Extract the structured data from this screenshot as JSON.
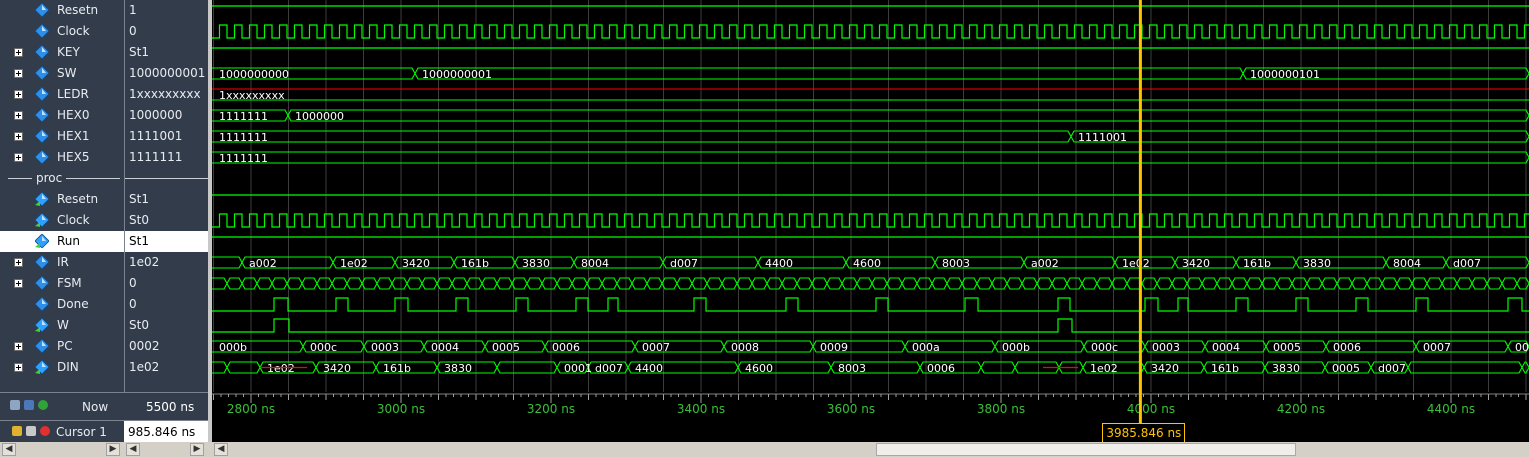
{
  "signals": [
    {
      "name": "Resetn",
      "value": "1",
      "expandable": false,
      "kind": "in"
    },
    {
      "name": "Clock",
      "value": "0",
      "expandable": false,
      "kind": "in"
    },
    {
      "name": "KEY",
      "value": "St1",
      "expandable": true,
      "kind": "in"
    },
    {
      "name": "SW",
      "value": "1000000001",
      "expandable": true,
      "kind": "in"
    },
    {
      "name": "LEDR",
      "value": "1xxxxxxxxx",
      "expandable": true,
      "kind": "in"
    },
    {
      "name": "HEX0",
      "value": "1000000",
      "expandable": true,
      "kind": "in"
    },
    {
      "name": "HEX1",
      "value": "1111001",
      "expandable": true,
      "kind": "in"
    },
    {
      "name": "HEX5",
      "value": "1111111",
      "expandable": true,
      "kind": "in"
    }
  ],
  "group": {
    "label": "proc"
  },
  "proc_signals": [
    {
      "name": "Resetn",
      "value": "St1",
      "expandable": false,
      "kind": "out"
    },
    {
      "name": "Clock",
      "value": "St0",
      "expandable": false,
      "kind": "out"
    },
    {
      "name": "Run",
      "value": "St1",
      "expandable": false,
      "kind": "out",
      "selected": true
    },
    {
      "name": "IR",
      "value": "1e02",
      "expandable": true,
      "kind": "in"
    },
    {
      "name": "FSM",
      "value": "0",
      "expandable": true,
      "kind": "in"
    },
    {
      "name": "Done",
      "value": "0",
      "expandable": false,
      "kind": "in"
    },
    {
      "name": "W",
      "value": "St0",
      "expandable": false,
      "kind": "out"
    },
    {
      "name": "PC",
      "value": "0002",
      "expandable": true,
      "kind": "in"
    },
    {
      "name": "DIN",
      "value": "1e02",
      "expandable": true,
      "kind": "out"
    }
  ],
  "now": {
    "label": "Now",
    "value": "5500 ns"
  },
  "cursor": {
    "label": "Cursor 1",
    "value": "985.846 ns",
    "flag": "3985.846 ns"
  },
  "time_axis": {
    "labels": [
      "2800 ns",
      "3000 ns",
      "3200 ns",
      "3400 ns",
      "3600 ns",
      "3800 ns",
      "4000 ns",
      "4200 ns",
      "4400 ns"
    ]
  },
  "bus_values": {
    "SW": [
      "1000000000",
      "1000000001",
      "1000000101"
    ],
    "LEDR": [
      "1xxxxxxxxx"
    ],
    "HEX0": [
      "1111111",
      "1000000"
    ],
    "HEX1": [
      "1111111",
      "1111001"
    ],
    "HEX5": [
      "1111111"
    ],
    "IR": [
      "a002",
      "1e02",
      "3420",
      "161b",
      "3830",
      "8004",
      "d007",
      "4400",
      "4600",
      "8003",
      "a002",
      "1e02",
      "3420",
      "161b",
      "3830",
      "8004",
      "d007"
    ],
    "PC": [
      "000b",
      "000c",
      "0003",
      "0004",
      "0005",
      "0006",
      "0007",
      "0008",
      "0009",
      "000a",
      "000b",
      "000c",
      "0003",
      "0004",
      "0005",
      "0006",
      "0007",
      "00"
    ],
    "DIN": [
      "1e02",
      "3420",
      "161b",
      "3830",
      "0001",
      "d007",
      "4400",
      "4600",
      "8003",
      "0006",
      "1e02",
      "3420",
      "161b",
      "3830",
      "0005",
      "d007"
    ]
  },
  "colors": {
    "wave": "#00ff00",
    "red": "#ff0000",
    "cursor": "#ffc400",
    "grid": "#3c3c3c",
    "pane": "#333c4a"
  }
}
